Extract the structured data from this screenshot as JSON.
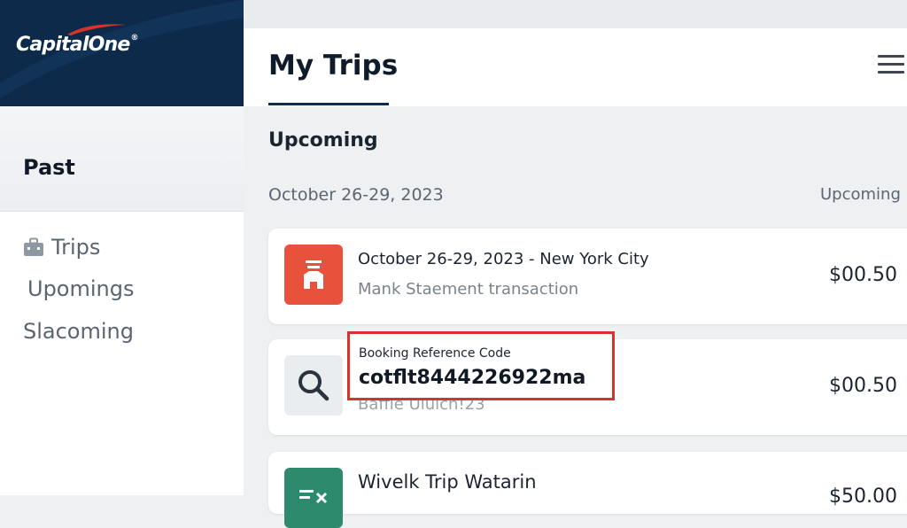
{
  "brand": {
    "logo_text": "Capital",
    "logo_text2": "One",
    "registered": "®"
  },
  "sidebar": {
    "section_label": "Past",
    "items": [
      {
        "label": "Trips",
        "icon": "briefcase-icon"
      },
      {
        "label": "Upomings"
      },
      {
        "label": "Slacoming"
      }
    ]
  },
  "header": {
    "title": "My Trips",
    "menu_icon": "hamburger-menu-icon"
  },
  "main": {
    "section_heading": "Upcoming",
    "date_range": "October 26-29, 2023",
    "upcoming_tag": "Upcoming",
    "trips": [
      {
        "title": "October 26-29, 2023 - New York City",
        "subtitle": "Mank Staement transaction",
        "price": "$00.50",
        "icon": "hotel-icon",
        "accent": "#e8523d"
      },
      {
        "subtitle": "Baffle Ululch!23",
        "price": "$00.50",
        "icon": "search-icon"
      },
      {
        "title": "Wivelk Trip Watarin",
        "price": "$50.00",
        "icon": "receipt-icon",
        "accent": "#2e8a6c"
      }
    ],
    "booking_reference": {
      "label": "Booking Reference Code",
      "code": "cotflt8444226922ma"
    }
  },
  "colors": {
    "brand_navy": "#0d2a4b",
    "brand_red": "#d8322c",
    "highlight_border": "#d8322c"
  }
}
